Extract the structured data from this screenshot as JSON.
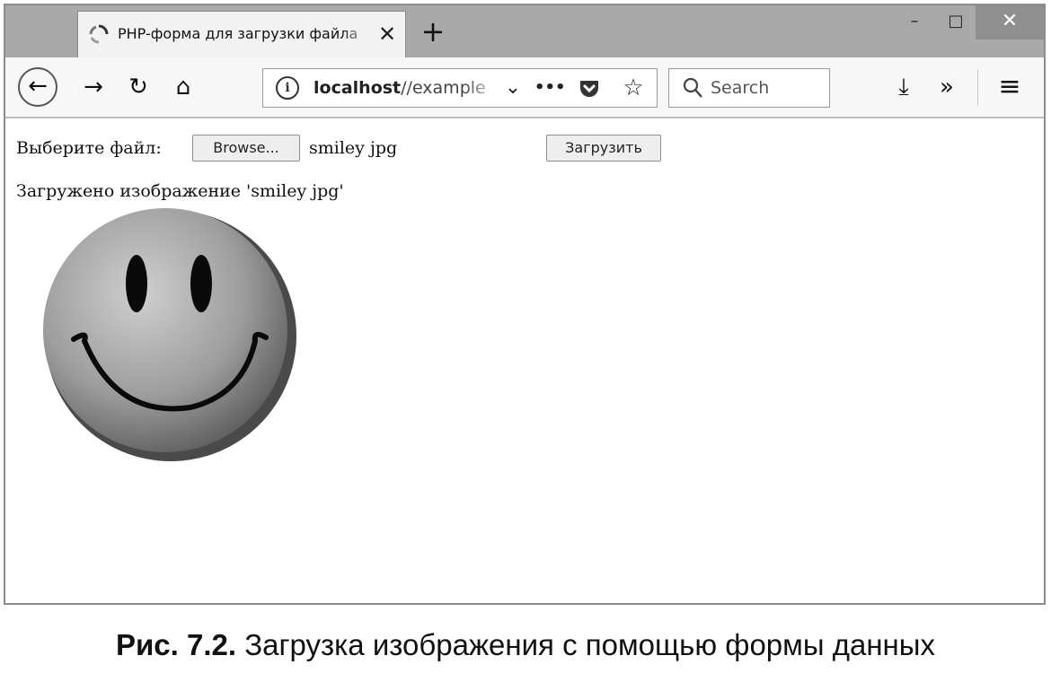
{
  "browser": {
    "tab_title": "PHP-форма для загрузки файла",
    "tab_close": "✕",
    "new_tab": "+",
    "window_controls": {
      "minimize": "–",
      "maximize": "□",
      "close": "✕"
    },
    "nav_icons": {
      "back": "←",
      "forward": "→",
      "reload": "↻",
      "home": "⌂",
      "dropdown": "⌄",
      "more": "•••",
      "pocket": "pocket-icon",
      "bookmark": "☆",
      "download": "⤓",
      "overflow": "»",
      "menu": "≡"
    },
    "url": {
      "info_icon": "i",
      "host": "localhost",
      "path": "//example"
    },
    "search": {
      "placeholder": "Search"
    }
  },
  "page": {
    "choose_file_label": "Выберите файл:",
    "browse_button": "Browse...",
    "selected_file": "smiley jpg",
    "upload_button": "Загрузить",
    "uploaded_message": "Загружено изображение 'smiley jpg'",
    "image": "smiley-face"
  },
  "caption": {
    "number": "Рис. 7.2.",
    "text": "Загрузка изображения с помощью формы данных"
  }
}
